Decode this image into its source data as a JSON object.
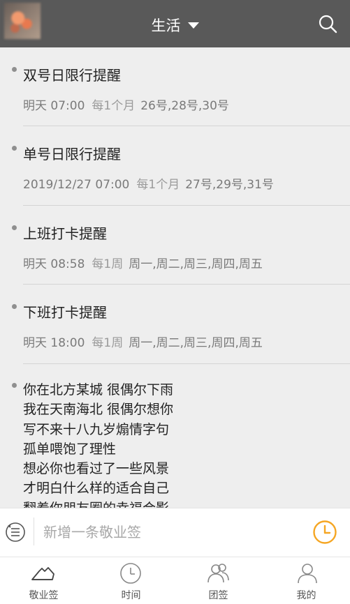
{
  "header": {
    "title": "生活"
  },
  "reminders": [
    {
      "title": "双号日限行提醒",
      "date": "明天 07:00",
      "repeat": "每1个月",
      "days": "26号,28号,30号"
    },
    {
      "title": "单号日限行提醒",
      "date": "2019/12/27 07:00",
      "repeat": "每1个月",
      "days": "27号,29号,31号"
    },
    {
      "title": "上班打卡提醒",
      "date": "明天 08:58",
      "repeat": "每1周",
      "days": "周一,周二,周三,周四,周五"
    },
    {
      "title": "下班打卡提醒",
      "date": "明天 18:00",
      "repeat": "每1周",
      "days": "周一,周二,周三,周四,周五"
    }
  ],
  "note": {
    "text": "你在北方某城 很偶尔下雨\n我在天南海北 很偶尔想你\n写不来十八九岁煽情字句\n孤单喂饱了理性\n想必你也看过了一些风景\n才明白什么样的适合自己\n翻着你朋友圈的幸福合影"
  },
  "composer": {
    "placeholder": "新增一条敬业签"
  },
  "tabs": [
    {
      "label": "敬业签",
      "icon": "notes-icon"
    },
    {
      "label": "时间",
      "icon": "clock-icon"
    },
    {
      "label": "团签",
      "icon": "group-icon"
    },
    {
      "label": "我的",
      "icon": "person-icon"
    }
  ],
  "colors": {
    "header_bg": "#595959",
    "accent": "#f5a623",
    "background": "#eeeeee"
  }
}
